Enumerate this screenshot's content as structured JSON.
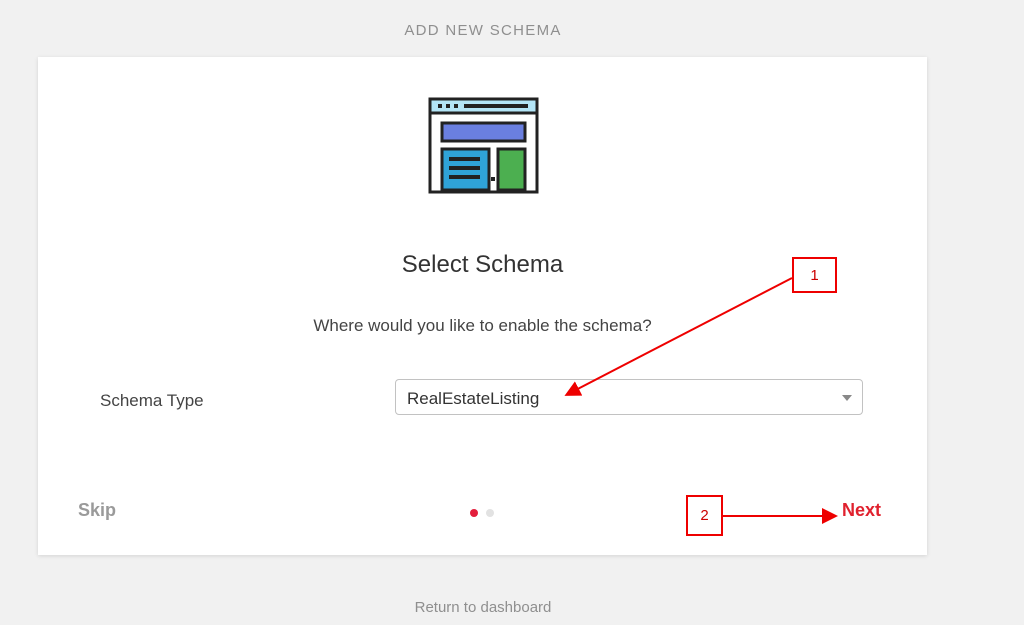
{
  "page": {
    "heading": "ADD NEW SCHEMA",
    "footer_link": "Return to dashboard"
  },
  "card": {
    "illustration": "webpage-layout-icon",
    "title": "Select Schema",
    "subtitle": "Where would you like to enable the schema?",
    "field": {
      "label": "Schema Type",
      "selected_value": "RealEstateListing"
    },
    "footer": {
      "skip_label": "Skip",
      "next_label": "Next",
      "steps_total": 2,
      "current_step": 1
    }
  },
  "annotations": {
    "callout_1": "1",
    "callout_2": "2",
    "color": "#ee0000"
  },
  "colors": {
    "accent": "#e0212e",
    "muted": "#9a9a9a",
    "background": "#f1f1f1"
  }
}
